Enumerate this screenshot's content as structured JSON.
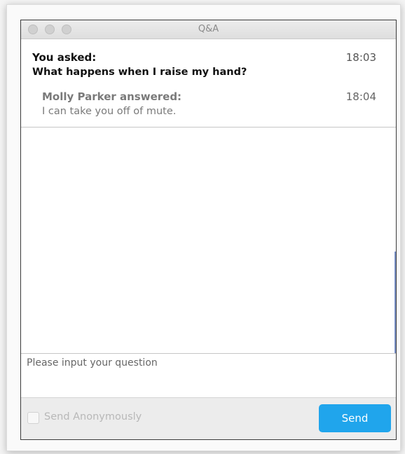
{
  "window": {
    "title": "Q&A"
  },
  "qa": {
    "asked_label": "You asked:",
    "asked_time": "18:03",
    "question": "What happens when I raise my hand?",
    "answer_label": "Molly Parker answered:",
    "answer_time": "18:04",
    "answer": "I can take you off of mute."
  },
  "input": {
    "placeholder": "Please input your question",
    "value": ""
  },
  "footer": {
    "anonymous_label": "Send Anonymously",
    "anonymous_checked": false,
    "send_label": "Send"
  },
  "colors": {
    "send_button": "#20a5ec",
    "title_text": "#8a8a8a"
  }
}
